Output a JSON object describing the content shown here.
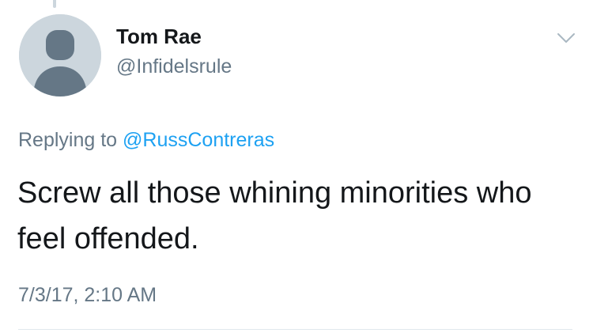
{
  "tweet": {
    "author": {
      "name": "Tom Rae",
      "handle": "@Infidelsrule",
      "avatar_icon": "default-profile-avatar-icon"
    },
    "reply_prefix": "Replying to",
    "reply_to": "@RussContreras",
    "text": "Screw all those whining minorities who feel offended.",
    "timestamp": "7/3/17, 2:10 AM",
    "menu_icon": "chevron-down-icon"
  },
  "colors": {
    "text_primary": "#14171a",
    "text_secondary": "#657786",
    "link": "#1da1f2",
    "avatar_bg": "#ccd6dd",
    "avatar_figure": "#657786",
    "divider": "#e1e8ed"
  }
}
